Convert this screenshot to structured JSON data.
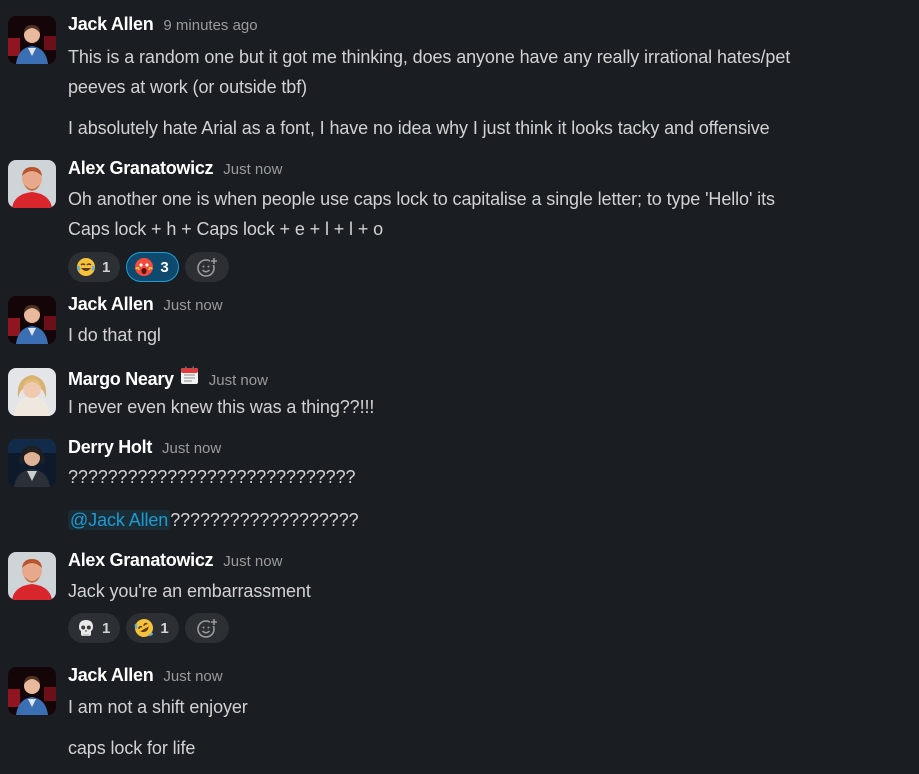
{
  "messages": [
    {
      "author": "Jack Allen",
      "time": "9 minutes ago",
      "lines": [
        "This is a random one but it got me thinking, does anyone have any really irrational hates/pet",
        "peeves at work (or outside tbf)",
        "I absolutely hate Arial as a font, I have no idea why I just think it looks tacky and offensive"
      ]
    },
    {
      "author": "Alex Granatowicz",
      "time": "Just now",
      "lines": [
        "Oh another one is when people use caps lock to capitalise a single letter; to type 'Hello' its",
        "Caps lock + h + Caps lock + e + l + l + o"
      ],
      "reactions": [
        {
          "emoji": "joy-emoji",
          "count": "1"
        },
        {
          "emoji": "scream-emoji",
          "count": "3",
          "active": true
        }
      ]
    },
    {
      "author": "Jack Allen",
      "time": "Just now",
      "lines": [
        "I do that ngl"
      ]
    },
    {
      "author": "Margo Neary",
      "status_icon": "calendar-emoji",
      "time": "Just now",
      "lines": [
        "I never even knew this was a thing??!!!"
      ]
    },
    {
      "author": "Derry Holt",
      "time": "Just now",
      "lines": [
        "?????????????????????????????",
        "???????????????????"
      ],
      "mention": "@Jack Allen"
    },
    {
      "author": "Alex Granatowicz",
      "time": "Just now",
      "lines": [
        "Jack you're an embarrassment"
      ],
      "reactions": [
        {
          "emoji": "skull-emoji",
          "count": "1"
        },
        {
          "emoji": "rofl-emoji",
          "count": "1"
        }
      ]
    },
    {
      "author": "Jack Allen",
      "time": "Just now",
      "lines": [
        "I am not a shift enjoyer",
        "caps lock for life"
      ]
    }
  ],
  "colors": {
    "background": "#1a1d21",
    "text": "#d1d2d3",
    "author": "#ffffff",
    "timestamp": "#9a9b9d",
    "mention": "#1d9bd1",
    "reaction_bg": "#2c2f33",
    "reaction_active_bg": "#0f4a6e"
  }
}
